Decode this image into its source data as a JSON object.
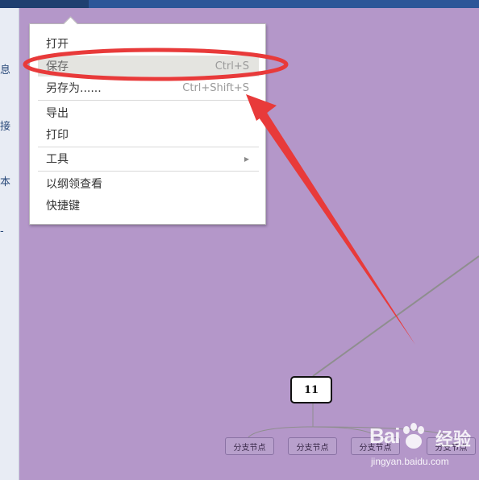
{
  "sidebar": {
    "chars": [
      "息",
      "接",
      "本",
      "-"
    ]
  },
  "menu": {
    "items": [
      {
        "label": "打开",
        "shortcut": ""
      },
      {
        "label": "保存",
        "shortcut": "Ctrl+S"
      },
      {
        "label": "另存为......",
        "shortcut": "Ctrl+Shift+S"
      },
      {
        "label": "导出",
        "shortcut": ""
      },
      {
        "label": "打印",
        "shortcut": ""
      },
      {
        "label": "工具",
        "shortcut": ""
      },
      {
        "label": "以纲领查看",
        "shortcut": ""
      },
      {
        "label": "快捷键",
        "shortcut": ""
      }
    ]
  },
  "mindmap": {
    "main_node": "11",
    "branches": [
      "分支节点",
      "分支节点",
      "分支节点",
      "分支节点"
    ]
  },
  "watermark": {
    "logo": "Bai",
    "cn": "经验",
    "url": "jingyan.baidu.com"
  },
  "colors": {
    "canvas": "#b497c9",
    "topbar": "#2c5698",
    "annotation": "#e83a3a"
  },
  "icons": {
    "submenu": "chevron-right-icon"
  }
}
